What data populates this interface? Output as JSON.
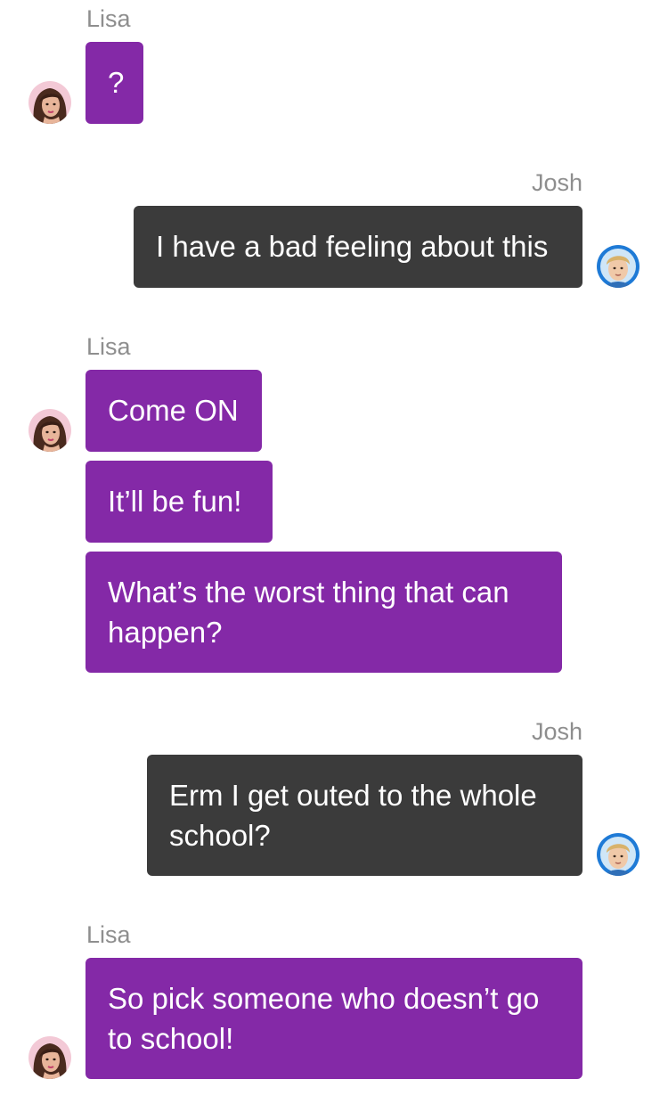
{
  "colors": {
    "lisa_bubble": "#8429a7",
    "josh_bubble": "#3b3b3b",
    "sender_name": "#8e8e8e",
    "bubble_text": "#ffffff"
  },
  "messages": [
    {
      "sender": "Lisa",
      "side": "left",
      "avatar_icon": "lisa-avatar-icon",
      "texts": [
        "?"
      ]
    },
    {
      "sender": "Josh",
      "side": "right",
      "avatar_icon": "josh-avatar-icon",
      "texts": [
        "I have a bad feeling about this"
      ]
    },
    {
      "sender": "Lisa",
      "side": "left",
      "avatar_icon": "lisa-avatar-icon",
      "texts": [
        "Come ON",
        "It’ll be fun!",
        "What’s the worst thing that can happen?"
      ]
    },
    {
      "sender": "Josh",
      "side": "right",
      "avatar_icon": "josh-avatar-icon",
      "texts": [
        "Erm I get outed to the whole school?"
      ]
    },
    {
      "sender": "Lisa",
      "side": "left",
      "avatar_icon": "lisa-avatar-icon",
      "texts": [
        "So pick someone who doesn’t go to school!"
      ]
    }
  ]
}
